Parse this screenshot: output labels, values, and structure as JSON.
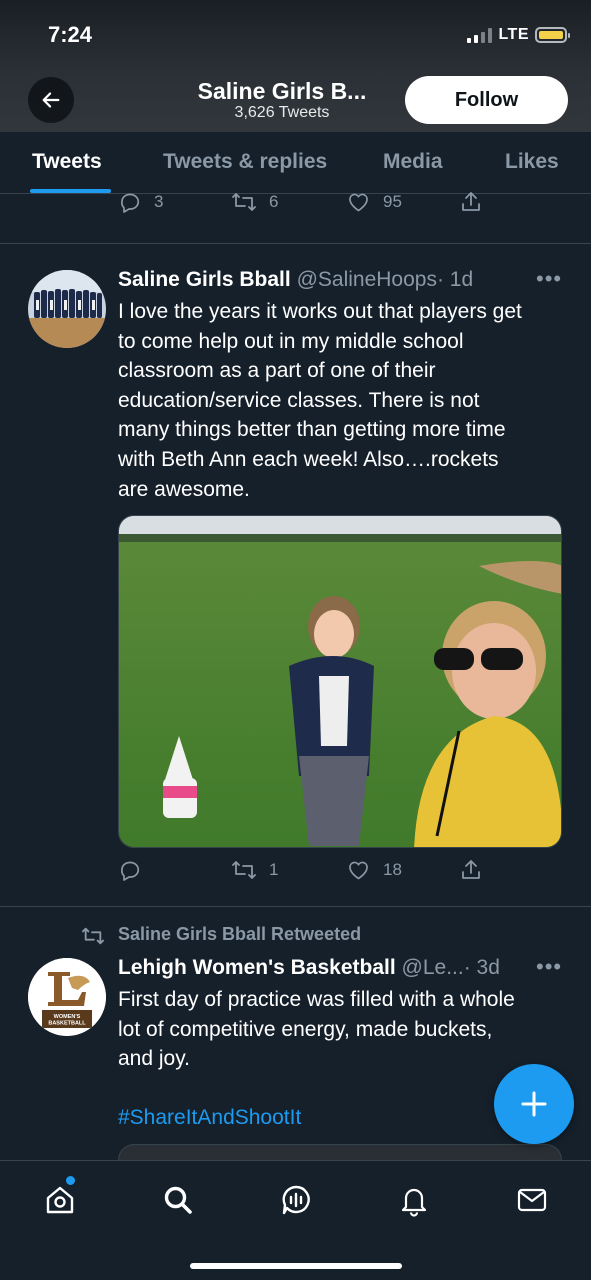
{
  "status_bar": {
    "time": "7:24",
    "network": "LTE"
  },
  "profile": {
    "name": "Saline Girls B...",
    "tweet_count": "3,626 Tweets",
    "follow_label": "Follow"
  },
  "tabs": [
    {
      "label": "Tweets",
      "active": true
    },
    {
      "label": "Tweets & replies",
      "active": false
    },
    {
      "label": "Media",
      "active": false
    },
    {
      "label": "Likes",
      "active": false
    }
  ],
  "tweets": [
    {
      "replies": "3",
      "retweets": "6",
      "likes": "95"
    },
    {
      "author": "Saline Girls Bball",
      "handle": "@SalineHoops",
      "time": "· 1d",
      "lines": [
        "I love the years it works out that players get",
        "to come help out in my middle school",
        "classroom as a part of one of their",
        "education/service classes. There is not",
        "many things better than getting more time",
        "with Beth Ann each week! Also….rockets",
        "are awesome."
      ],
      "replies": "",
      "retweets": "1",
      "likes": "18"
    },
    {
      "retweeted_by": "Saline Girls Bball Retweeted",
      "author": "Lehigh Women's Basketball",
      "handle": "@Le...",
      "time": "· 3d",
      "lines": [
        "First day of practice was filled with a whole",
        "lot of competitive energy, made buckets,",
        "and joy."
      ],
      "hashtag": "#ShareItAndShootIt",
      "logo_text": [
        "WOMEN'S",
        "BASKETBALL"
      ]
    }
  ],
  "colors": {
    "background": "#15202b",
    "accent": "#1d9bf0",
    "muted": "#8b98a5",
    "divider": "#38444d"
  },
  "icons": [
    "back-arrow-icon",
    "reply-icon",
    "retweet-icon",
    "like-icon",
    "share-icon",
    "more-icon",
    "compose-icon",
    "home-icon",
    "search-icon",
    "spaces-icon",
    "bell-icon",
    "mail-icon"
  ]
}
